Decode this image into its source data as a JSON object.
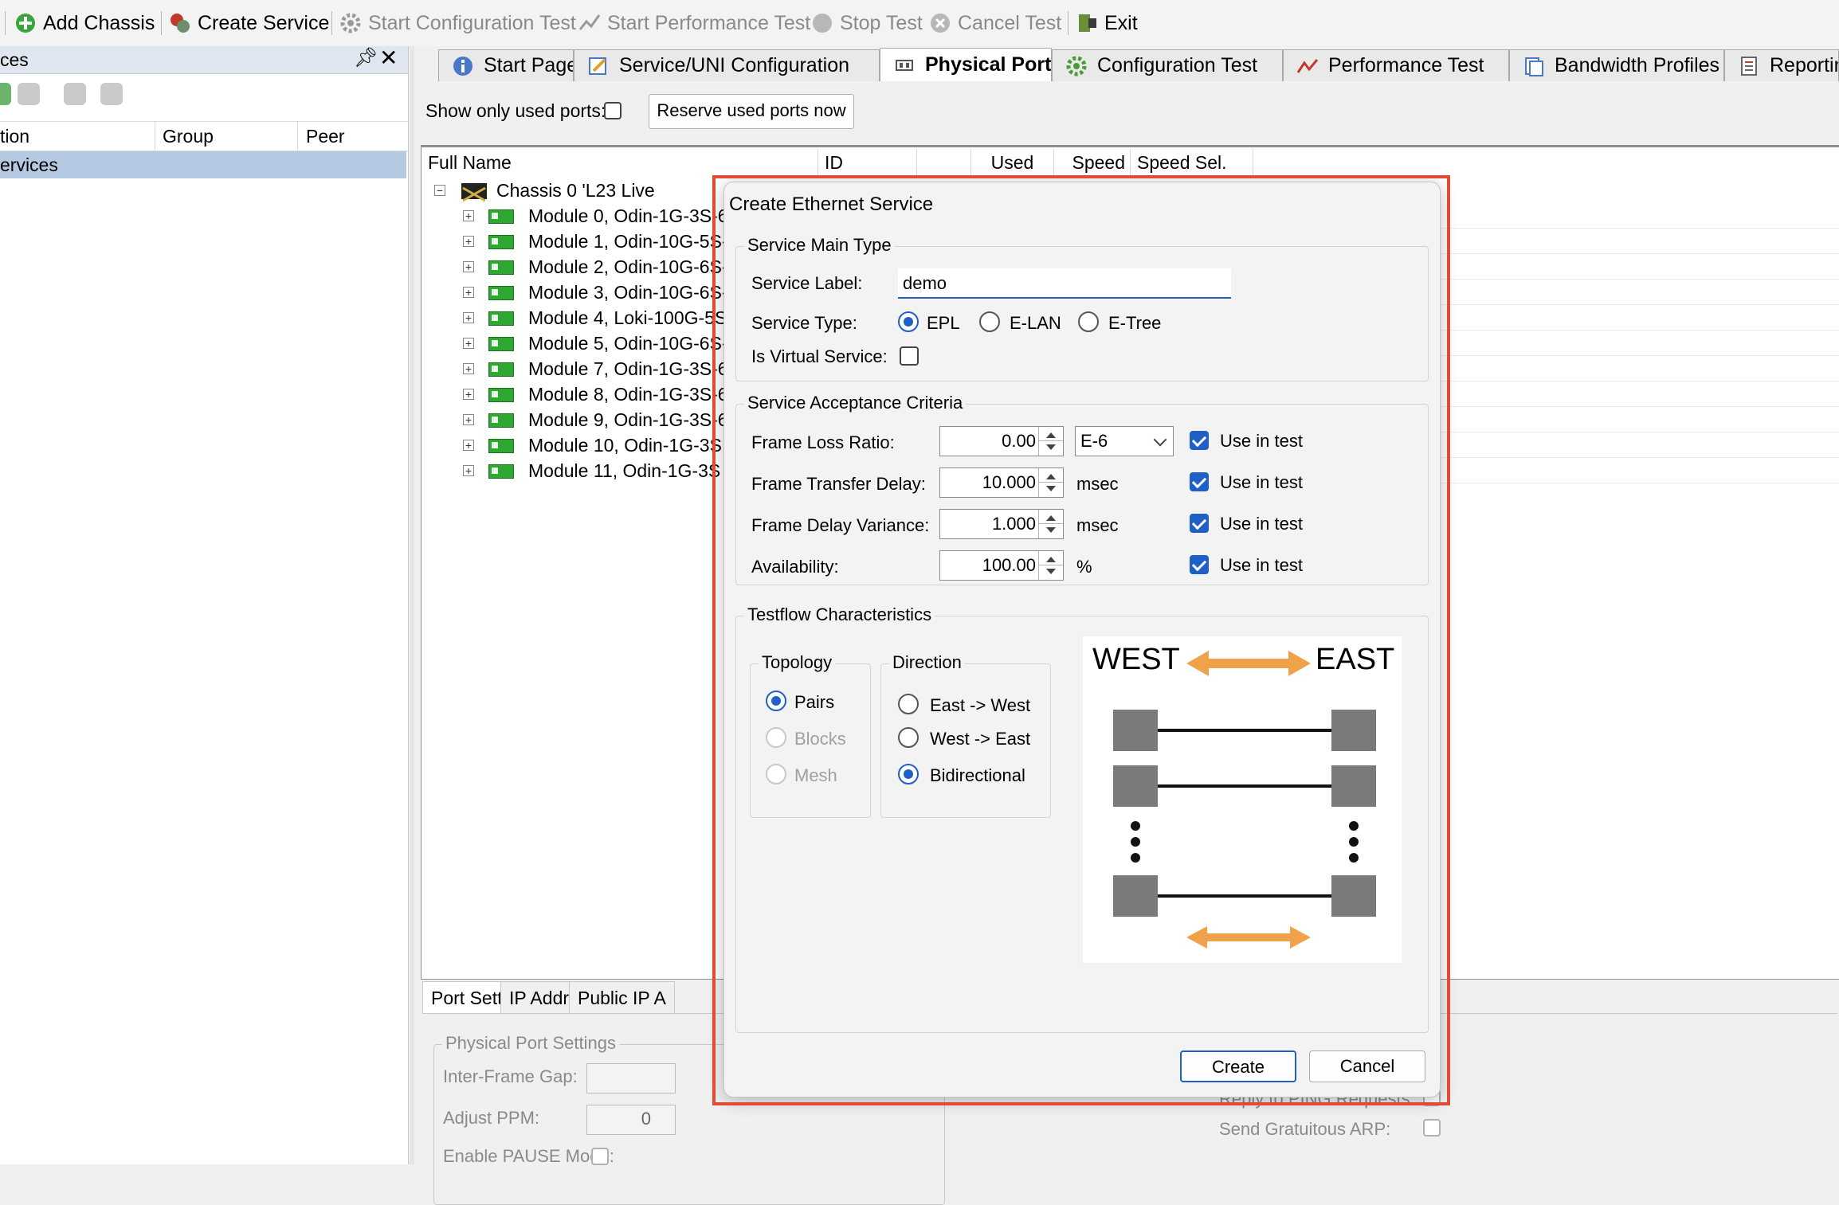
{
  "toolbar": {
    "add_chassis": "Add Chassis",
    "create_service": "Create Service",
    "start_config_test": "Start Configuration Test",
    "start_perf_test": "Start Performance Test",
    "stop_test": "Stop Test",
    "cancel_test": "Cancel Test",
    "exit": "Exit"
  },
  "left_panel": {
    "title": "ces",
    "pin": "ᵖ",
    "close": "✕",
    "columns": [
      "tion",
      "Group",
      "Peer"
    ],
    "selected_row": "ervices"
  },
  "tabs": [
    {
      "label": "Start Page",
      "icon": "info-icon"
    },
    {
      "label": "Service/UNI Configuration",
      "icon": "edit-icon"
    },
    {
      "label": "Physical Ports",
      "icon": "ports-icon"
    },
    {
      "label": "Configuration Test",
      "icon": "gear-icon"
    },
    {
      "label": "Performance Test",
      "icon": "graph-icon"
    },
    {
      "label": "Bandwidth Profiles",
      "icon": "pages-icon"
    },
    {
      "label": "Reportin",
      "icon": "report-icon"
    }
  ],
  "main": {
    "show_used_label": "Show only used ports:",
    "reserve_button": "Reserve used ports now",
    "columns": [
      "Full Name",
      "ID",
      "Used",
      "Speed",
      "Speed Sel."
    ],
    "chassis": "Chassis 0 'L23 Live",
    "modules": [
      "Module 0, Odin-1G-3S-6",
      "Module 1, Odin-10G-5S-",
      "Module 2, Odin-10G-6S-",
      "Module 3, Odin-10G-6S-",
      "Module 4, Loki-100G-5S",
      "Module 5, Odin-10G-6S-",
      "Module 7, Odin-1G-3S-6",
      "Module 8, Odin-1G-3S-6",
      "Module 9, Odin-1G-3S-6",
      "Module 10, Odin-1G-3S",
      "Module 11, Odin-1G-3S"
    ]
  },
  "bottom": {
    "tabs": [
      "Port Settings",
      "IP Address",
      "Public IP A"
    ],
    "group_title": "Physical Port Settings",
    "inter_frame_gap": "Inter-Frame Gap:",
    "adjust_ppm": "Adjust PPM:",
    "adjust_ppm_value": "0",
    "enable_pause": "Enable PAUSE Mode:",
    "reply_ping": "Reply to PING Requests:",
    "send_arp": "Send Gratuitous ARP:"
  },
  "dialog": {
    "title": "Create Ethernet Service",
    "main_type": {
      "group_title": "Service Main Type",
      "label_label": "Service Label:",
      "label_value": "demo",
      "type_label": "Service Type:",
      "types": [
        "EPL",
        "E-LAN",
        "E-Tree"
      ],
      "selected_type": "EPL",
      "virtual_label": "Is Virtual Service:"
    },
    "acceptance": {
      "group_title": "Service Acceptance Criteria",
      "rows": [
        {
          "label": "Frame Loss Ratio:",
          "value": "0.00",
          "unit": "E-6",
          "check": "Use in test"
        },
        {
          "label": "Frame Transfer Delay:",
          "value": "10.000",
          "unit": "msec",
          "check": "Use in test"
        },
        {
          "label": "Frame Delay Variance:",
          "value": "1.000",
          "unit": "msec",
          "check": "Use in test"
        },
        {
          "label": "Availability:",
          "value": "100.00",
          "unit": "%",
          "check": "Use in test"
        }
      ]
    },
    "testflow": {
      "group_title": "Testflow Characteristics",
      "topology_title": "Topology",
      "topology": [
        "Pairs",
        "Blocks",
        "Mesh"
      ],
      "direction_title": "Direction",
      "direction": [
        "East -> West",
        "West -> East",
        "Bidirectional"
      ],
      "west": "WEST",
      "east": "EAST"
    },
    "create_button": "Create",
    "cancel_button": "Cancel"
  },
  "colors": {
    "accent": "#1f5fc8",
    "highlight": "#e24a33",
    "arrow": "#f0a24a",
    "selection": "#b6c9e3"
  }
}
